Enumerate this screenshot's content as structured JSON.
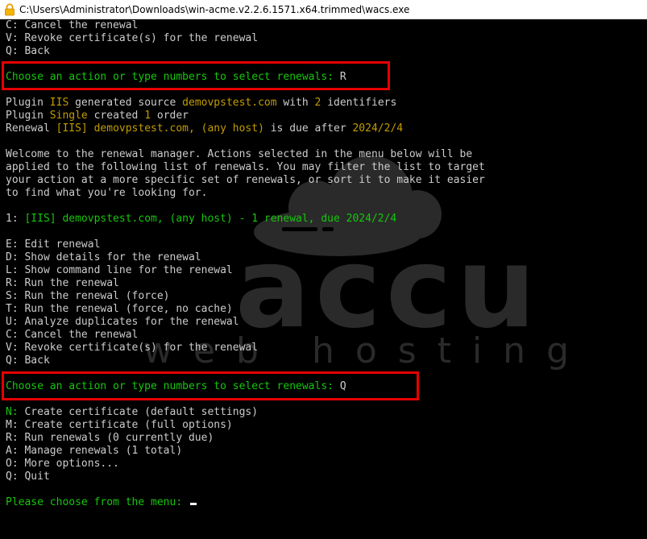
{
  "window": {
    "title": "C:\\Users\\Administrator\\Downloads\\win-acme.v2.2.6.1571.x64.trimmed\\wacs.exe"
  },
  "watermark": {
    "main": "accu",
    "sub": "web hosting"
  },
  "colors": {
    "background": "#000000",
    "text": "#cccccc",
    "green": "#16c60c",
    "yellow": "#c19c00",
    "highlight": "#e60000"
  },
  "console": {
    "l1": {
      "key": "C:",
      "text": " Cancel the renewal"
    },
    "l2": {
      "key": "V:",
      "text": " Revoke certificate(s) for the renewal"
    },
    "l3": {
      "key": "Q:",
      "text": " Back"
    },
    "prompt1": {
      "text": "Choose an action or type numbers to select renewals: ",
      "input": "R"
    },
    "plugin1": {
      "a": "Plugin ",
      "b": "IIS",
      "c": " generated source ",
      "d": "demovpstest.com",
      "e": " with ",
      "f": "2",
      "g": " identifiers"
    },
    "plugin2": {
      "a": "Plugin ",
      "b": "Single",
      "c": " created ",
      "d": "1",
      "e": " order"
    },
    "renewal": {
      "a": "Renewal ",
      "b": "[IIS] demovpstest.com, (any host)",
      "c": " is due after ",
      "d": "2024/2/4"
    },
    "welcome": [
      "Welcome to the renewal manager. Actions selected in the menu below will be",
      "applied to the following list of renewals. You may filter the list to target",
      "your action at a more specific set of renewals, or sort it to make it easier",
      "to find what you're looking for."
    ],
    "item": {
      "num": "1:",
      "text": " [IIS] demovpstest.com, (any host) - 1 renewal, due 2024/2/4"
    },
    "menu": [
      {
        "key": "E:",
        "text": " Edit renewal"
      },
      {
        "key": "D:",
        "text": " Show details for the renewal"
      },
      {
        "key": "L:",
        "text": " Show command line for the renewal"
      },
      {
        "key": "R:",
        "text": " Run the renewal"
      },
      {
        "key": "S:",
        "text": " Run the renewal (force)"
      },
      {
        "key": "T:",
        "text": " Run the renewal (force, no cache)"
      },
      {
        "key": "U:",
        "text": " Analyze duplicates for the renewal"
      },
      {
        "key": "C:",
        "text": " Cancel the renewal"
      },
      {
        "key": "V:",
        "text": " Revoke certificate(s) for the renewal"
      },
      {
        "key": "Q:",
        "text": " Back"
      }
    ],
    "prompt2": {
      "text": "Choose an action or type numbers to select renewals: ",
      "input": "Q"
    },
    "main_menu": [
      {
        "key": "N:",
        "text": " Create certificate (default settings)"
      },
      {
        "key": "M:",
        "text": " Create certificate (full options)"
      },
      {
        "key": "R:",
        "text": " Run renewals (0 currently due)"
      },
      {
        "key": "A:",
        "text": " Manage renewals (1 total)"
      },
      {
        "key": "O:",
        "text": " More options..."
      },
      {
        "key": "Q:",
        "text": " Quit"
      }
    ],
    "prompt3": {
      "text": "Please choose from the menu: "
    }
  }
}
